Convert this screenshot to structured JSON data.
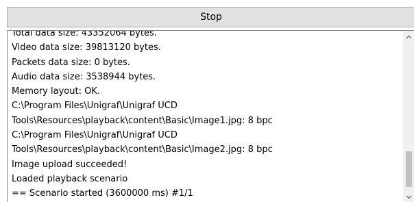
{
  "toolbar": {
    "stop_label": "Stop"
  },
  "log": {
    "lines": [
      "Total data size: 43352064 bytes.",
      "Video data size: 39813120 bytes.",
      "Packets data size: 0 bytes.",
      "Audio data size: 3538944 bytes.",
      "Memory layout: OK.",
      "C:\\Program Files\\Unigraf\\Unigraf UCD",
      "Tools\\Resources\\playback\\content\\Basic\\Image1.jpg: 8 bpc",
      "C:\\Program Files\\Unigraf\\Unigraf UCD",
      "Tools\\Resources\\playback\\content\\Basic\\Image2.jpg: 8 bpc",
      "Image upload succeeded!",
      "Loaded playback scenario",
      "== Scenario started (3600000 ms) #1/1"
    ]
  },
  "scrollbar": {
    "up_icon": "chevron-up-icon",
    "down_icon": "chevron-down-icon"
  }
}
